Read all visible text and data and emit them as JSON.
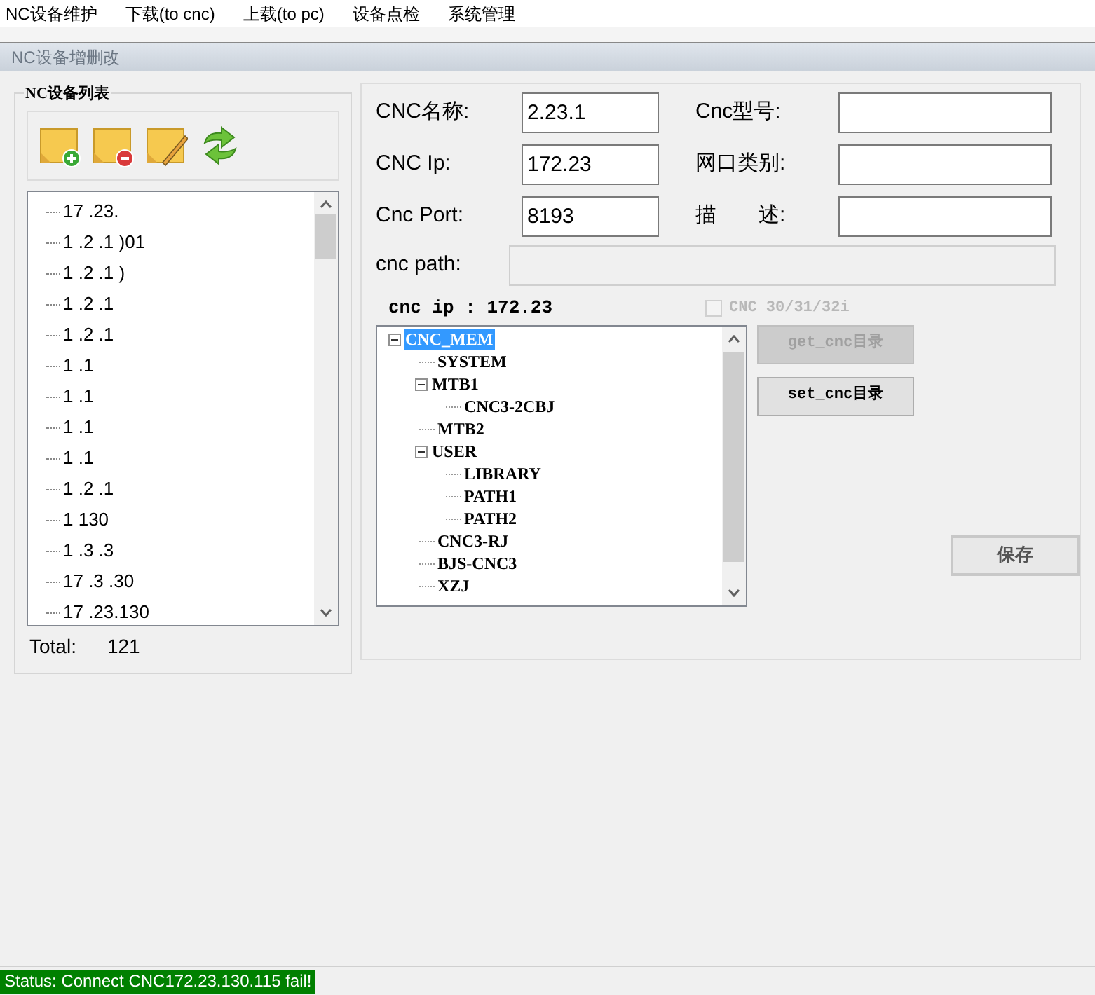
{
  "menu": [
    "NC设备维护",
    "下载(to cnc)",
    "上载(to pc)",
    "设备点检",
    "系统管理"
  ],
  "window": {
    "title": "NC设备增删改"
  },
  "device_list": {
    "title": "NC设备列表",
    "items": [
      "17 .23.",
      "1 .2 .1 )01",
      "1 .2 .1 )",
      "1 .2 .1",
      "1 .2 .1",
      "1 .1",
      "1 .1",
      "1 .1",
      "1 .1",
      "1 .2 .1",
      "1 130",
      "1 .3 .3",
      "17 .3 .30",
      "17 .23.130"
    ],
    "total_label": "Total:",
    "total_value": "121"
  },
  "form": {
    "fields": [
      {
        "label": "CNC名称:",
        "value": "2.23.1"
      },
      {
        "label": "Cnc型号:"
      },
      {
        "label": "CNC Ip:",
        "value": "172.23"
      },
      {
        "label": "网口类别:"
      },
      {
        "label": "Cnc Port:",
        "value": "8193"
      },
      {
        "label": "描　　述:"
      }
    ],
    "path_label": "cnc path:",
    "path_disabled": true
  },
  "cnc_ip_label": "cnc ip : 172.23",
  "series_checkbox": {
    "label": "CNC 30/31/32i",
    "checked": false,
    "disabled": true
  },
  "tree": [
    {
      "label": "CNC_MEM",
      "selected": true,
      "expanded": true,
      "children": [
        {
          "label": "SYSTEM",
          "selected": false
        },
        {
          "label": "MTB1",
          "selected": false,
          "expanded": true,
          "children": [
            {
              "label": "CNC3-2CBJ",
              "selected": false
            }
          ]
        },
        {
          "label": "MTB2",
          "selected": false
        },
        {
          "label": "USER",
          "selected": false,
          "expanded": true,
          "children": [
            {
              "label": "LIBRARY",
              "selected": false
            },
            {
              "label": "PATH1",
              "selected": false
            },
            {
              "label": "PATH2",
              "selected": false
            }
          ]
        },
        {
          "label": "CNC3-RJ",
          "selected": false
        },
        {
          "label": "BJS-CNC3",
          "selected": false
        },
        {
          "label": "XZJ",
          "selected": false
        }
      ]
    }
  ],
  "buttons": [
    {
      "label": "get_cnc目录",
      "disabled": true
    },
    {
      "label": "set_cnc目录",
      "disabled": false
    }
  ],
  "save_button": "保存",
  "status": "Status: Connect CNC172.23.130.115 fail!"
}
